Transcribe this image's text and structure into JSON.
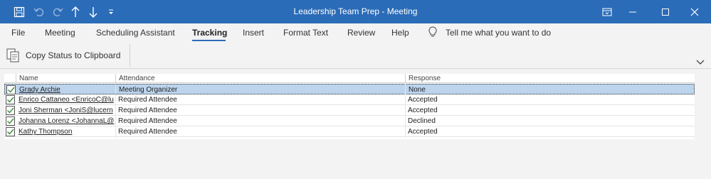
{
  "window": {
    "title": "Leadership Team Prep  -  Meeting",
    "colors": {
      "titlebar": "#2b6cb8",
      "selected_row": "#bcd4ec",
      "check": "#3a8a3a"
    }
  },
  "quick_access": {
    "icons": [
      "save-icon",
      "undo-icon",
      "redo-icon",
      "up-arrow-icon",
      "down-arrow-icon",
      "customize-icon"
    ]
  },
  "tabs": {
    "file": "File",
    "meeting": "Meeting",
    "scheduling": "Scheduling Assistant",
    "tracking": "Tracking",
    "insert": "Insert",
    "format_text": "Format Text",
    "review": "Review",
    "help": "Help",
    "tell_me": "Tell me what you want to do"
  },
  "ribbon": {
    "copy_status": "Copy Status to Clipboard"
  },
  "table": {
    "columns": {
      "name": "Name",
      "attendance": "Attendance",
      "response": "Response"
    },
    "rows": [
      {
        "name": "Grady Archie",
        "attendance": "Meeting Organizer",
        "response": "None"
      },
      {
        "name": "Enrico Cattaneo <EnricoC@lu",
        "attendance": "Required Attendee",
        "response": "Accepted"
      },
      {
        "name": "Joni Sherman <JoniS@lucern",
        "attendance": "Required Attendee",
        "response": "Accepted"
      },
      {
        "name": "Johanna Lorenz <JohannaL@",
        "attendance": "Required Attendee",
        "response": "Declined"
      },
      {
        "name": "Kathy Thompson",
        "attendance": "Required Attendee",
        "response": "Accepted"
      }
    ]
  }
}
